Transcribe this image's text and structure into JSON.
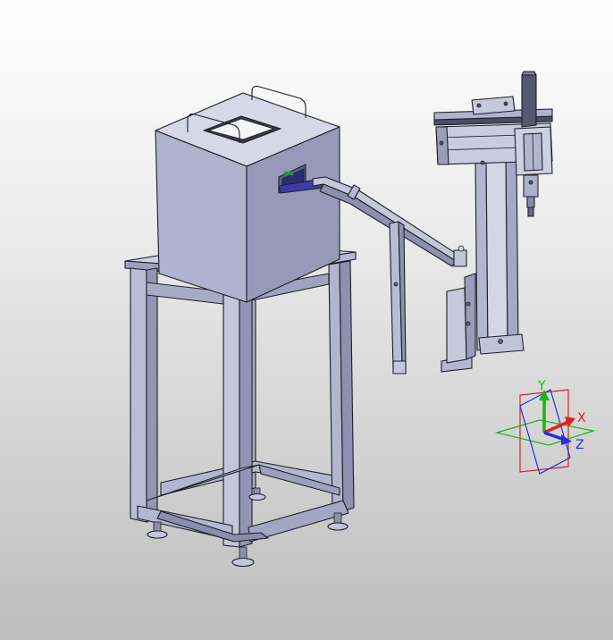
{
  "viewer": {
    "colors": {
      "background_top": "#ffffff",
      "background_bottom": "#bdbdbd",
      "part_light": "#d2d4e6",
      "part_mid": "#aeb1cc",
      "part_dark": "#868aa8",
      "accent_blue": "#3c3ca8",
      "accent_green": "#2e8b57"
    },
    "triad": {
      "x_label": "X",
      "y_label": "Y",
      "z_label": "Z",
      "x_color": "#e02020",
      "y_color": "#18b418",
      "z_color": "#2030e0"
    }
  }
}
